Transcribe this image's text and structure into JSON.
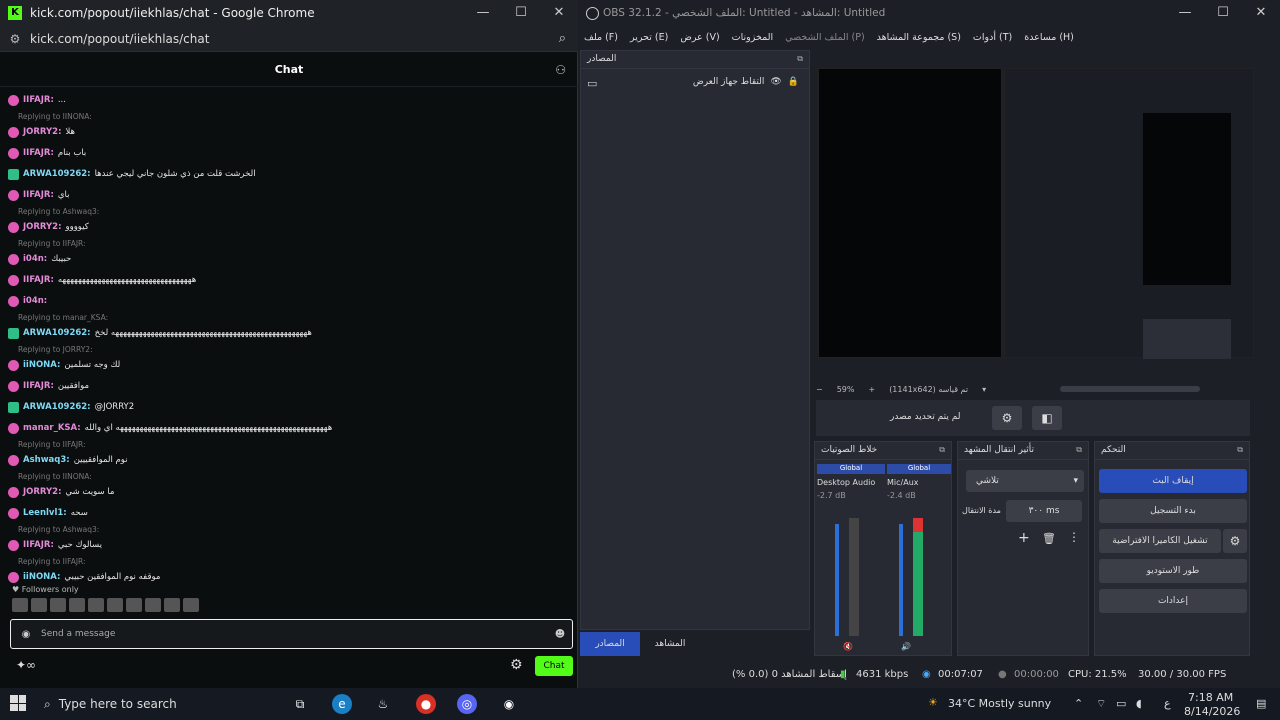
{
  "chrome": {
    "title": "kick.com/popout/iiekhlas/chat - Google Chrome",
    "url": "kick.com/popout/iiekhlas/chat",
    "chat_header": "Chat",
    "followers_only": "Followers only",
    "input_placeholder": "Send a message",
    "chat_button": "Chat",
    "messages": [
      {
        "type": "line",
        "user": "IIFAJR:",
        "text": "..."
      },
      {
        "type": "reply",
        "text": "Replying to IINONA:"
      },
      {
        "type": "line",
        "user": "JORRY2:",
        "text": "هلا"
      },
      {
        "type": "line",
        "user": "IIFAJR:",
        "text": "باب بنام"
      },
      {
        "type": "line",
        "user": "ARWA109262:",
        "text": "الخرشت قلت من ذي شلون جاني ليجي عندها"
      },
      {
        "type": "line",
        "user": "IIFAJR:",
        "text": "باي"
      },
      {
        "type": "reply",
        "text": "Replying to Ashwaq3:"
      },
      {
        "type": "line",
        "user": "JORRY2:",
        "text": "كيوووو"
      },
      {
        "type": "reply",
        "text": "Replying to IIFAJR:"
      },
      {
        "type": "line",
        "user": "i04n:",
        "text": "حبيبك"
      },
      {
        "type": "line",
        "user": "IIFAJR:",
        "text": "ههههههههههههههههههههههههههههههههههه"
      },
      {
        "type": "line",
        "user": "i04n:",
        "text": ""
      },
      {
        "type": "reply",
        "text": "Replying to manar_KSA:"
      },
      {
        "type": "line",
        "user": "ARWA109262:",
        "text": "ههههههههههههههههههههههههههههههههههههههههههههههههههه لخخ"
      },
      {
        "type": "reply",
        "text": "Replying to JORRY2:"
      },
      {
        "type": "line",
        "user": "iiNONA:",
        "text": "لك وجه تسلمين"
      },
      {
        "type": "line",
        "user": "IIFAJR:",
        "text": "موافقيين"
      },
      {
        "type": "line",
        "user": "ARWA109262:",
        "text": "@JORRY2"
      },
      {
        "type": "line",
        "user": "manar_KSA:",
        "text": "ههههههههههههههههههههههههههههههههههههههههههههههههههههههه اي والله"
      },
      {
        "type": "reply",
        "text": "Replying to IIFAJR:"
      },
      {
        "type": "line",
        "user": "Ashwaq3:",
        "text": "نوم الموافقييين"
      },
      {
        "type": "reply",
        "text": "Replying to IINONA:"
      },
      {
        "type": "line",
        "user": "JORRY2:",
        "text": "ما سويت شي"
      },
      {
        "type": "line",
        "user": "Leenlvl1:",
        "text": "سحه"
      },
      {
        "type": "reply",
        "text": "Replying to Ashwaq3:"
      },
      {
        "type": "line",
        "user": "IIFAJR:",
        "text": "يسالوك حبي"
      },
      {
        "type": "reply",
        "text": "Replying to IIFAJR:"
      },
      {
        "type": "line",
        "user": "iiNONA:",
        "text": "موقفه نوم الموافقين حبيبي"
      }
    ]
  },
  "obs": {
    "title": "OBS 32.1.2 - الملف الشخصي: Untitled - المشاهد: Untitled",
    "menu": [
      "ملف (F)",
      "تحرير (E)",
      "عرض (V)",
      "المخزونات",
      "الملف الشخصي (P)",
      "مجموعة المشاهد (S)",
      "أدوات (T)",
      "مساعدة (H)"
    ],
    "sources_title": "المصادر",
    "source_item": "التقاط جهاز العرض",
    "preview_zoom": "59%",
    "preview_size": "(1141x642) تم قياسه",
    "no_source": "لم يتم تحديد مصدر",
    "mixer_title": "خلاط الصوتيات",
    "transitions_title": "تأثير انتقال المشهد",
    "controls_title": "التحكم",
    "mixer": [
      {
        "scope": "Global",
        "name": "Desktop Audio",
        "db": "-2.7 dB"
      },
      {
        "scope": "Global",
        "name": "Mic/Aux",
        "db": "-2.4 dB"
      }
    ],
    "transition": "تلاشي",
    "duration_label": "مدة الانتقال",
    "duration_value": "٣٠٠ ms",
    "controls": [
      "إيقاف البث",
      "بدء التسجيل",
      "تشغيل الكاميرا الافتراضية",
      "طور الاستوديو",
      "إعدادات"
    ],
    "tab_sources": "المصادر",
    "tab_scenes": "المشاهد",
    "status": {
      "dropped": "إسقاط المشاهد 0 (0.0 %)",
      "bitrate": "4631 kbps",
      "live": "00:07:07",
      "rec": "00:00:00",
      "cpu": "CPU: 21.5%",
      "fps": "30.00 / 30.00 FPS"
    }
  },
  "taskbar": {
    "search": "Type here to search",
    "weather": "34°C  Mostly sunny",
    "time": "7:18 AM",
    "date": "8/14/2026",
    "lang": "ع"
  }
}
